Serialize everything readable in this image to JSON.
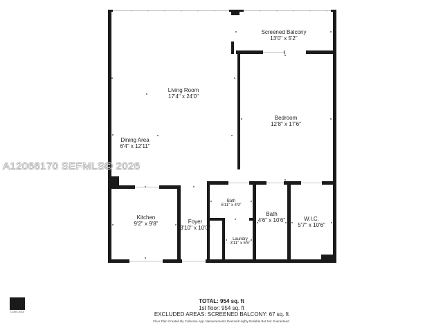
{
  "rooms": {
    "screened_balcony": {
      "name": "Screened Balcony",
      "dim": "13'0\" x 5'2\""
    },
    "living_room": {
      "name": "Living Room",
      "dim": "17'4\" x 24'0\""
    },
    "bedroom": {
      "name": "Bedroom",
      "dim": "12'8\" x 17'6\""
    },
    "dining_area": {
      "name": "Dining Area",
      "dim": "6'4\" x 12'11\""
    },
    "kitchen": {
      "name": "Kitchen",
      "dim": "9'2\" x 9'8\""
    },
    "foyer": {
      "name": "Foyer",
      "dim": "3'10\" x 10'0\""
    },
    "bath_small": {
      "name": "Bath",
      "dim": "5'11\" x 4'9\""
    },
    "laundry": {
      "name": "Laundry",
      "dim": "3'11\" x 5'5\""
    },
    "bath_large": {
      "name": "Bath",
      "dim": "4'6\" x 10'6\""
    },
    "wic": {
      "name": "W.I.C.",
      "dim": "5'7\" x 10'6\""
    }
  },
  "watermark": "A12066170  SEFMLS© 2026",
  "totals": {
    "total": "TOTAL: 954 sq. ft",
    "floor": "1st floor: 954 sq. ft",
    "excluded": "EXCLUDED AREAS: SCREENED BALCONY: 67 sq. ft",
    "disclaimer": "Floor Plan Created By Cubicasa App. Measurements Deemed Highly Reliable But Not Guaranteed."
  },
  "logo_text": "CUBICASA",
  "colors": {
    "wall": "#1a1a1a",
    "background": "#ffffff"
  }
}
